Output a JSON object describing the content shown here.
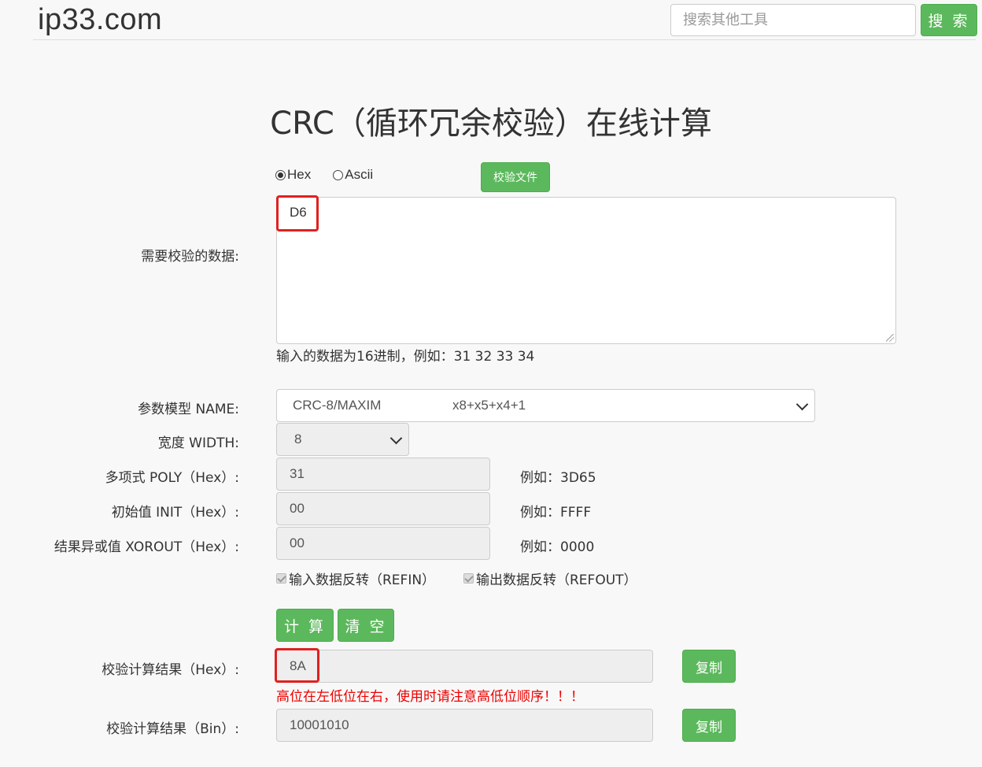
{
  "header": {
    "logo": "ip33.com",
    "search_placeholder": "搜索其他工具",
    "search_button": "搜 索"
  },
  "page_title": "CRC（循环冗余校验）在线计算",
  "input_mode": {
    "options": [
      "Hex",
      "Ascii"
    ],
    "selected": "Hex",
    "file_button": "校验文件"
  },
  "data_input": {
    "label": "需要校验的数据:",
    "value": "D6",
    "hint": "输入的数据为16进制，例如：31 32 33 34"
  },
  "params": {
    "model_label": "参数模型 NAME:",
    "model_name": "CRC-8/MAXIM",
    "model_poly": "x8+x5+x4+1",
    "width_label": "宽度 WIDTH:",
    "width_value": "8",
    "poly_label": "多项式 POLY（Hex）:",
    "poly_value": "31",
    "poly_example": "例如：3D65",
    "init_label": "初始值 INIT（Hex）:",
    "init_value": "00",
    "init_example": "例如：FFFF",
    "xorout_label": "结果异或值 XOROUT（Hex）:",
    "xorout_value": "00",
    "xorout_example": "例如：0000",
    "refin_label": "输入数据反转（REFIN）",
    "refout_label": "输出数据反转（REFOUT）"
  },
  "actions": {
    "calculate": "计 算",
    "clear": "清 空"
  },
  "results": {
    "hex_label": "校验计算结果（Hex）:",
    "hex_value": "8A",
    "copy_label": "复制",
    "warning": "高位在左低位在右，使用时请注意高低位顺序！！！",
    "bin_label": "校验计算结果（Bin）:",
    "bin_value": "10001010"
  },
  "colors": {
    "button_green": "#5cb85c",
    "highlight_red": "#e02020",
    "warning_red": "#e00000"
  }
}
